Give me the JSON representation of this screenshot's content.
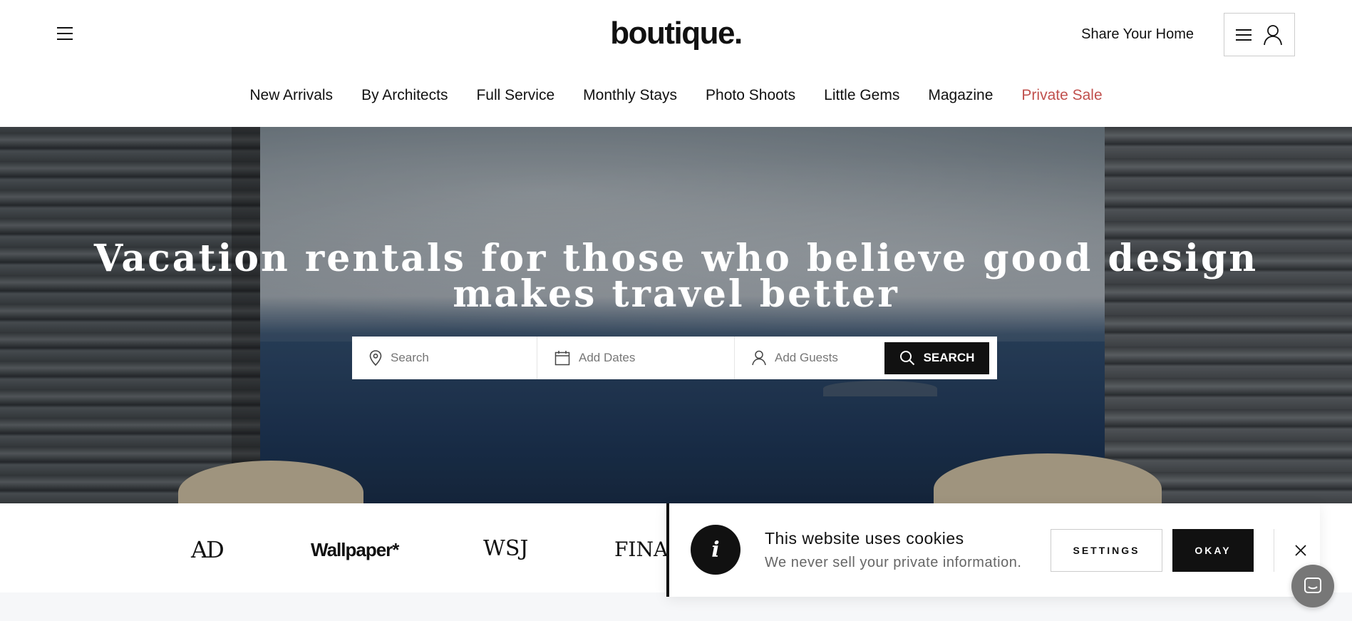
{
  "header": {
    "logo_text": "boutique.",
    "share_link": "Share Your Home",
    "menu_icon": "hamburger-icon",
    "account_icon": "user-icon"
  },
  "nav": {
    "items": [
      {
        "label": "New Arrivals"
      },
      {
        "label": "By Architects"
      },
      {
        "label": "Full Service"
      },
      {
        "label": "Monthly Stays"
      },
      {
        "label": "Photo Shoots"
      },
      {
        "label": "Little Gems"
      },
      {
        "label": "Magazine"
      },
      {
        "label": "Private Sale"
      }
    ],
    "sale_color": "#c0504d"
  },
  "hero": {
    "title_line1": "Vacation rentals for those who believe good design",
    "title_line2": "makes travel better"
  },
  "search": {
    "location_placeholder": "Search",
    "dates_placeholder": "Add Dates",
    "guests_placeholder": "Add Guests",
    "button_label": "SEARCH"
  },
  "press": {
    "logos": [
      "AD",
      "Wallpaper*",
      "WSJ",
      "FINA"
    ]
  },
  "cookie": {
    "title": "This website uses cookies",
    "subtitle": "We never sell your private information.",
    "settings_label": "SETTINGS",
    "okay_label": "OKAY",
    "info_glyph": "i"
  }
}
